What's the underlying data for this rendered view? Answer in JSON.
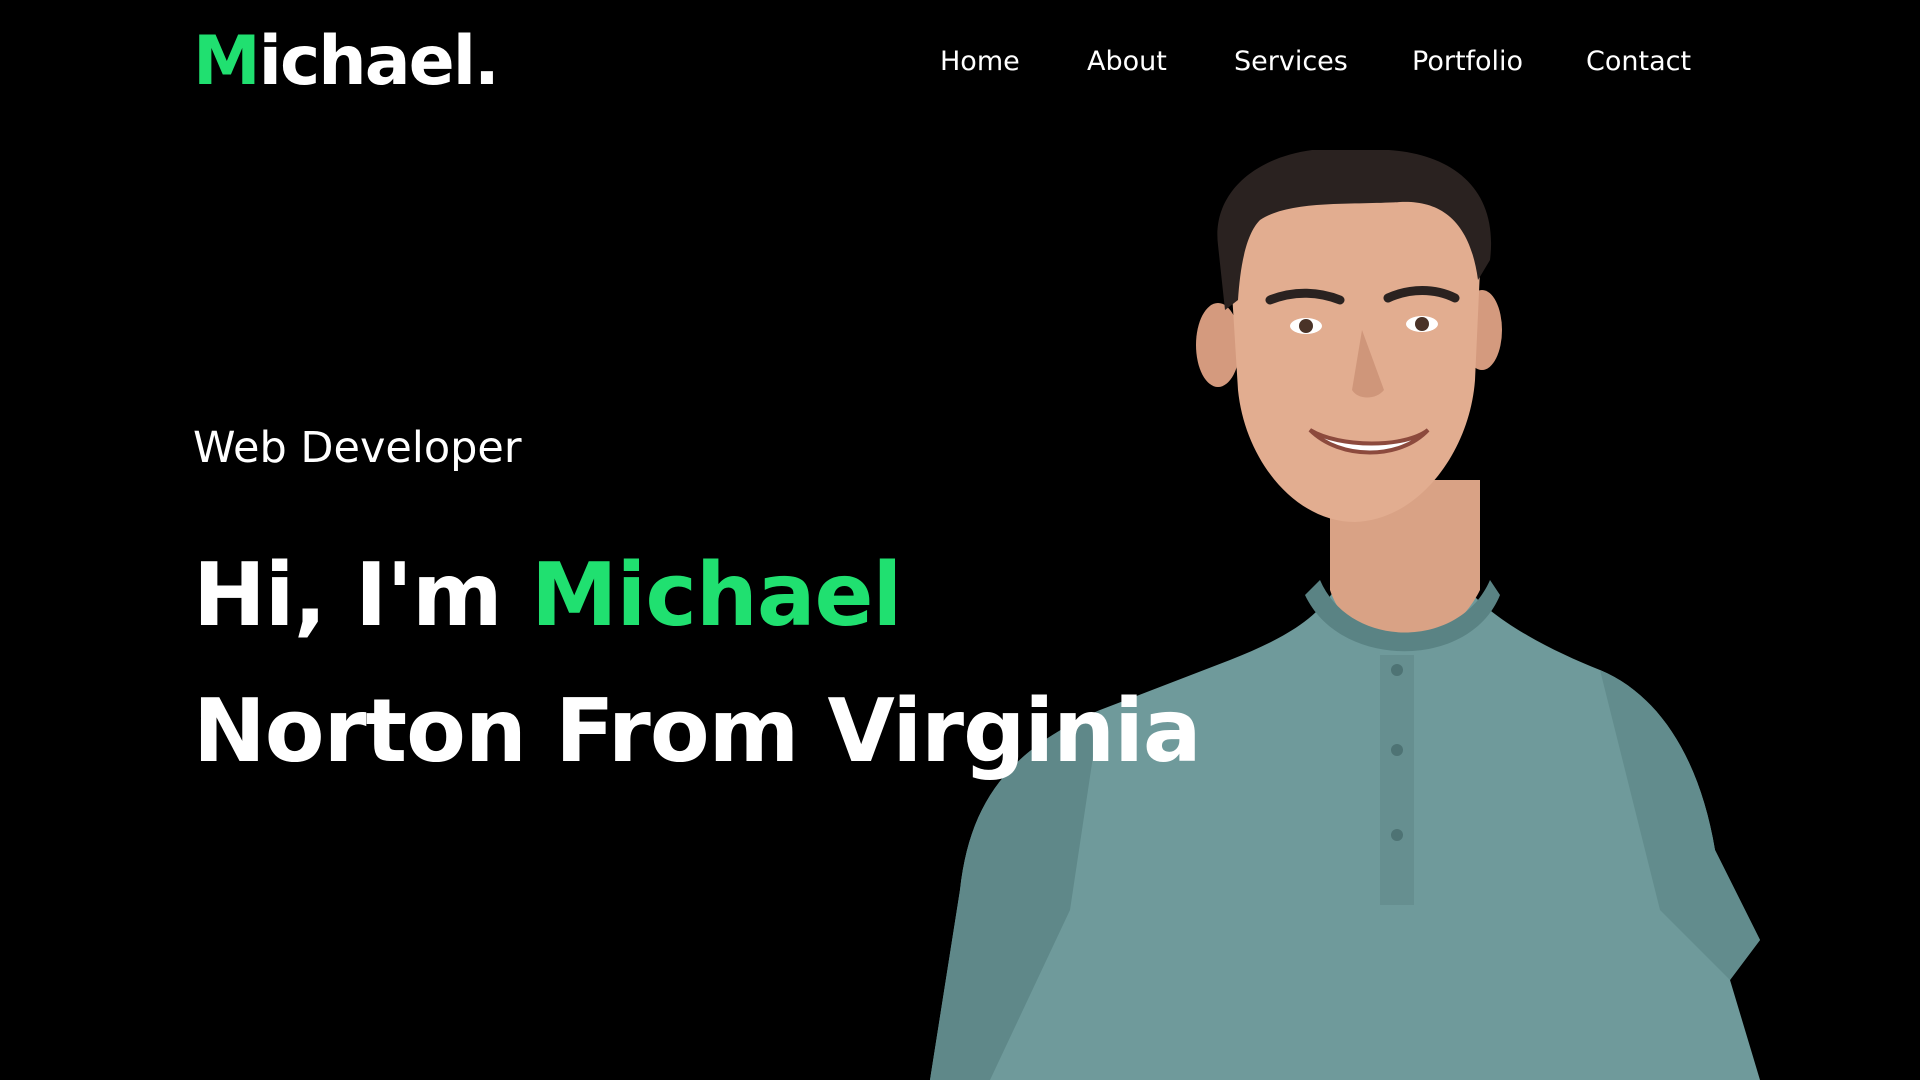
{
  "header": {
    "logo_first": "M",
    "logo_rest": "ichael."
  },
  "nav": {
    "items": [
      "Home",
      "About",
      "Services",
      "Portfolio",
      "Contact"
    ]
  },
  "hero": {
    "subtitle": "Web Developer",
    "greeting": "Hi, I'm",
    "name": "Michael",
    "line2": "Norton From Virginia"
  },
  "colors": {
    "background": "#000000",
    "accent": "#20e070",
    "text": "#ffffff",
    "shirt": "#6f9a9b"
  },
  "image": {
    "icon": "portrait-photo"
  }
}
